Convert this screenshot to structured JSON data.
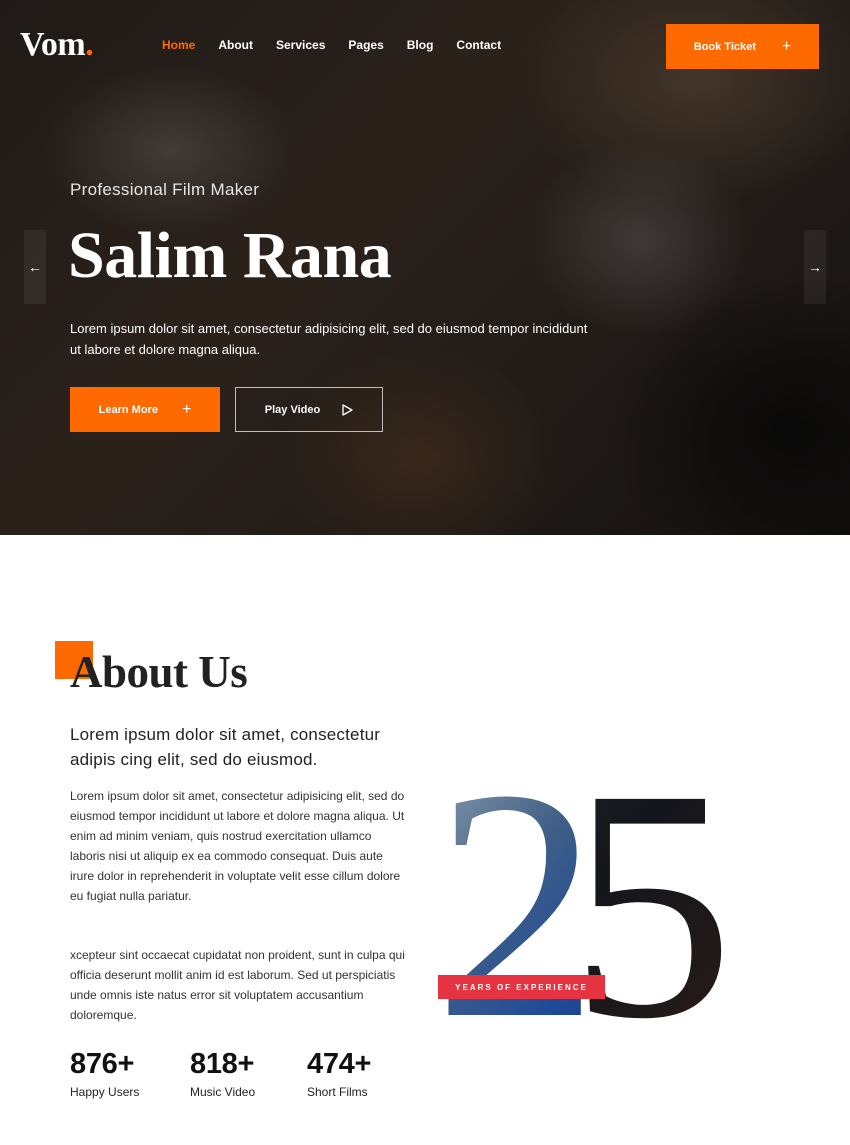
{
  "brand": {
    "name": "Vom",
    "dot": ".",
    "accent_color": "#ff6a00"
  },
  "nav": {
    "items": [
      "Home",
      "About",
      "Services",
      "Pages",
      "Blog",
      "Contact"
    ],
    "active": "Home"
  },
  "header": {
    "book_label": "Book Ticket",
    "book_icon": "plus-icon"
  },
  "hero": {
    "subtitle": "Professional Film Maker",
    "title": "Salim Rana",
    "text": "Lorem ipsum dolor sit amet, consectetur adipisicing elit, sed do eiusmod tempor incididunt ut labore et dolore magna aliqua.",
    "learn_label": "Learn More",
    "learn_icon": "plus-icon",
    "play_label": "Play Video",
    "play_icon": "play-icon",
    "prev_icon": "arrow-left-icon",
    "next_icon": "arrow-right-icon"
  },
  "about": {
    "title": "About Us",
    "lead": "Lorem ipsum dolor sit amet, consectetur adipis cing elit, sed do eiusmod.",
    "paragraph1": "Lorem ipsum dolor sit amet, consectetur adipisicing elit, sed do eiusmod tempor incididunt ut labore et dolore magna aliqua. Ut enim ad minim veniam, quis nostrud exercitation ullamco laboris nisi ut aliquip ex ea commodo consequat. Duis aute irure dolor in reprehenderit in voluptate velit esse cillum dolore eu fugiat nulla pariatur.",
    "paragraph2": "xcepteur sint occaecat cupidatat non proident, sunt in culpa qui officia deserunt mollit anim id est laborum. Sed ut perspiciatis unde omnis iste natus error sit voluptatem accusantium doloremque.",
    "years_number": "25",
    "years_label": "YEARS OF EXPERIENCE",
    "badge_color": "#e63342"
  },
  "stats": [
    {
      "value": "876+",
      "label": "Happy Users"
    },
    {
      "value": "818+",
      "label": "Music Video"
    },
    {
      "value": "474+",
      "label": "Short Films"
    }
  ]
}
